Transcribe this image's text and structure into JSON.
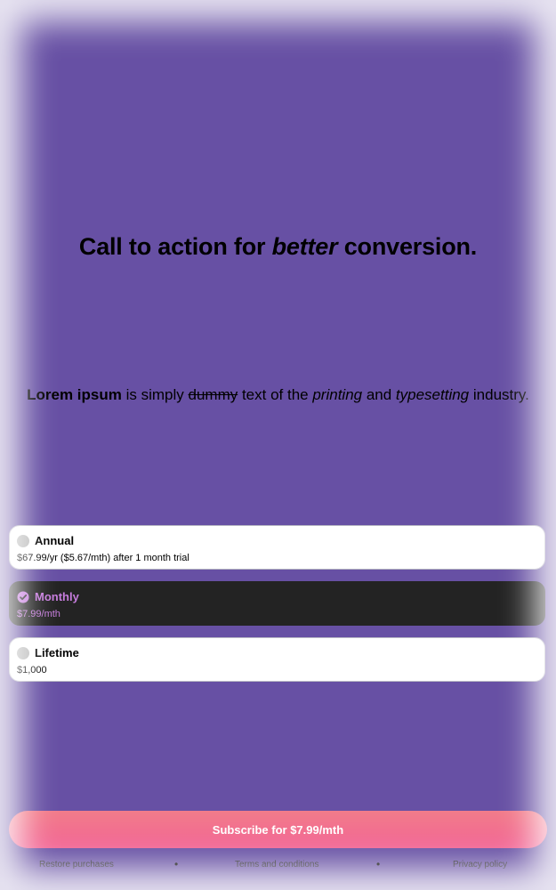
{
  "headline": {
    "before": "Call to action for ",
    "emphasis": "better",
    "after": " conversion."
  },
  "subline": {
    "bold": "Lorem ipsum",
    "text1": " is simply ",
    "struck": "dummy",
    "text2": " text of the ",
    "italic1": "printing",
    "text3": " and ",
    "italic2": "typesetting",
    "text4": " industry."
  },
  "plans": [
    {
      "name": "Annual",
      "price": "$67.99/yr ($5.67/mth) after 1 month trial",
      "selected": false
    },
    {
      "name": "Monthly",
      "price": "$7.99/mth",
      "selected": true
    },
    {
      "name": "Lifetime",
      "price": "$1,000",
      "selected": false
    }
  ],
  "cta": {
    "label": "Subscribe for $7.99/mth"
  },
  "footer": {
    "restore": "Restore purchases",
    "terms": "Terms and conditions",
    "privacy": "Privacy policy",
    "separator": "•"
  },
  "colors": {
    "background": "#6750a4",
    "selected_card": "#232323",
    "selected_accent": "#c77dde",
    "cta_gradient_start": "#f27c8a",
    "cta_gradient_end": "#f26594"
  }
}
